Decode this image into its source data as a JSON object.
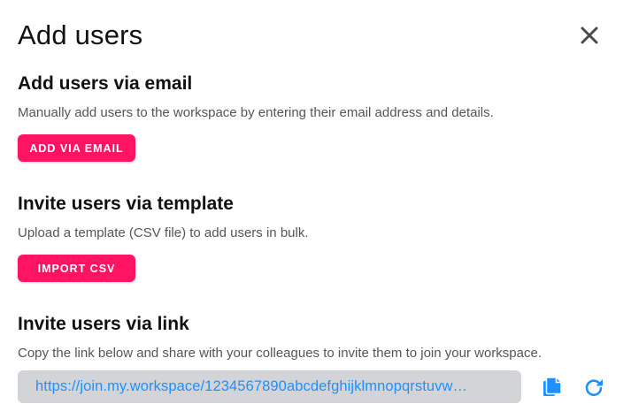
{
  "dialog": {
    "title": "Add users"
  },
  "sections": {
    "email": {
      "title": "Add users via email",
      "description": "Manually add users to the workspace by entering their email address and details.",
      "button_label": "ADD VIA EMAIL"
    },
    "template": {
      "title": "Invite users via template",
      "description": "Upload a template (CSV file) to add users in bulk.",
      "button_label": "IMPORT CSV"
    },
    "link": {
      "title": "Invite users via link",
      "description": "Copy the link below and share with your colleagues to invite them to join your workspace.",
      "invite_link": "https://join.my.workspace/1234567890abcdefghijklmnopqrstuvw…"
    }
  },
  "icons": {
    "close": "close-icon",
    "copy": "copy-icon",
    "refresh": "refresh-icon"
  },
  "colors": {
    "accent": "#ff1463",
    "link": "#1e90ff",
    "field_background": "#d3d4d7",
    "icon_blue": "#1e90ff",
    "close_gray": "#4a4a4a"
  }
}
